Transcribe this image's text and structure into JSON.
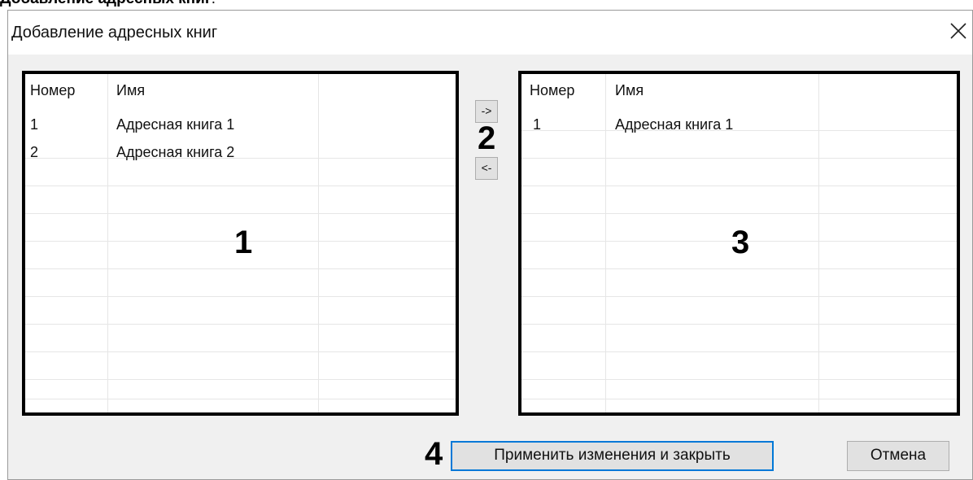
{
  "caption": {
    "bold": "Добавление адресных книг",
    "rest": "."
  },
  "dialog": {
    "title": "Добавление адресных книг",
    "close_icon": "close-icon"
  },
  "left_list": {
    "columns": [
      "Номер",
      "Имя"
    ],
    "rows": [
      {
        "num": "1",
        "name": "Адресная книга 1"
      },
      {
        "num": "2",
        "name": "Адресная книга 2"
      }
    ],
    "marker": "1"
  },
  "right_list": {
    "columns": [
      "Номер",
      "Имя"
    ],
    "rows": [
      {
        "num": "1",
        "name": "Адресная книга 1"
      }
    ],
    "marker": "3"
  },
  "transfer": {
    "add_label": "->",
    "remove_label": "<-",
    "marker": "2"
  },
  "buttons": {
    "apply_label": "Применить изменения и закрыть",
    "apply_marker": "4",
    "cancel_label": "Отмена"
  },
  "colors": {
    "dialog_bg": "#f0f0f0",
    "focus_border": "#0078d7"
  }
}
